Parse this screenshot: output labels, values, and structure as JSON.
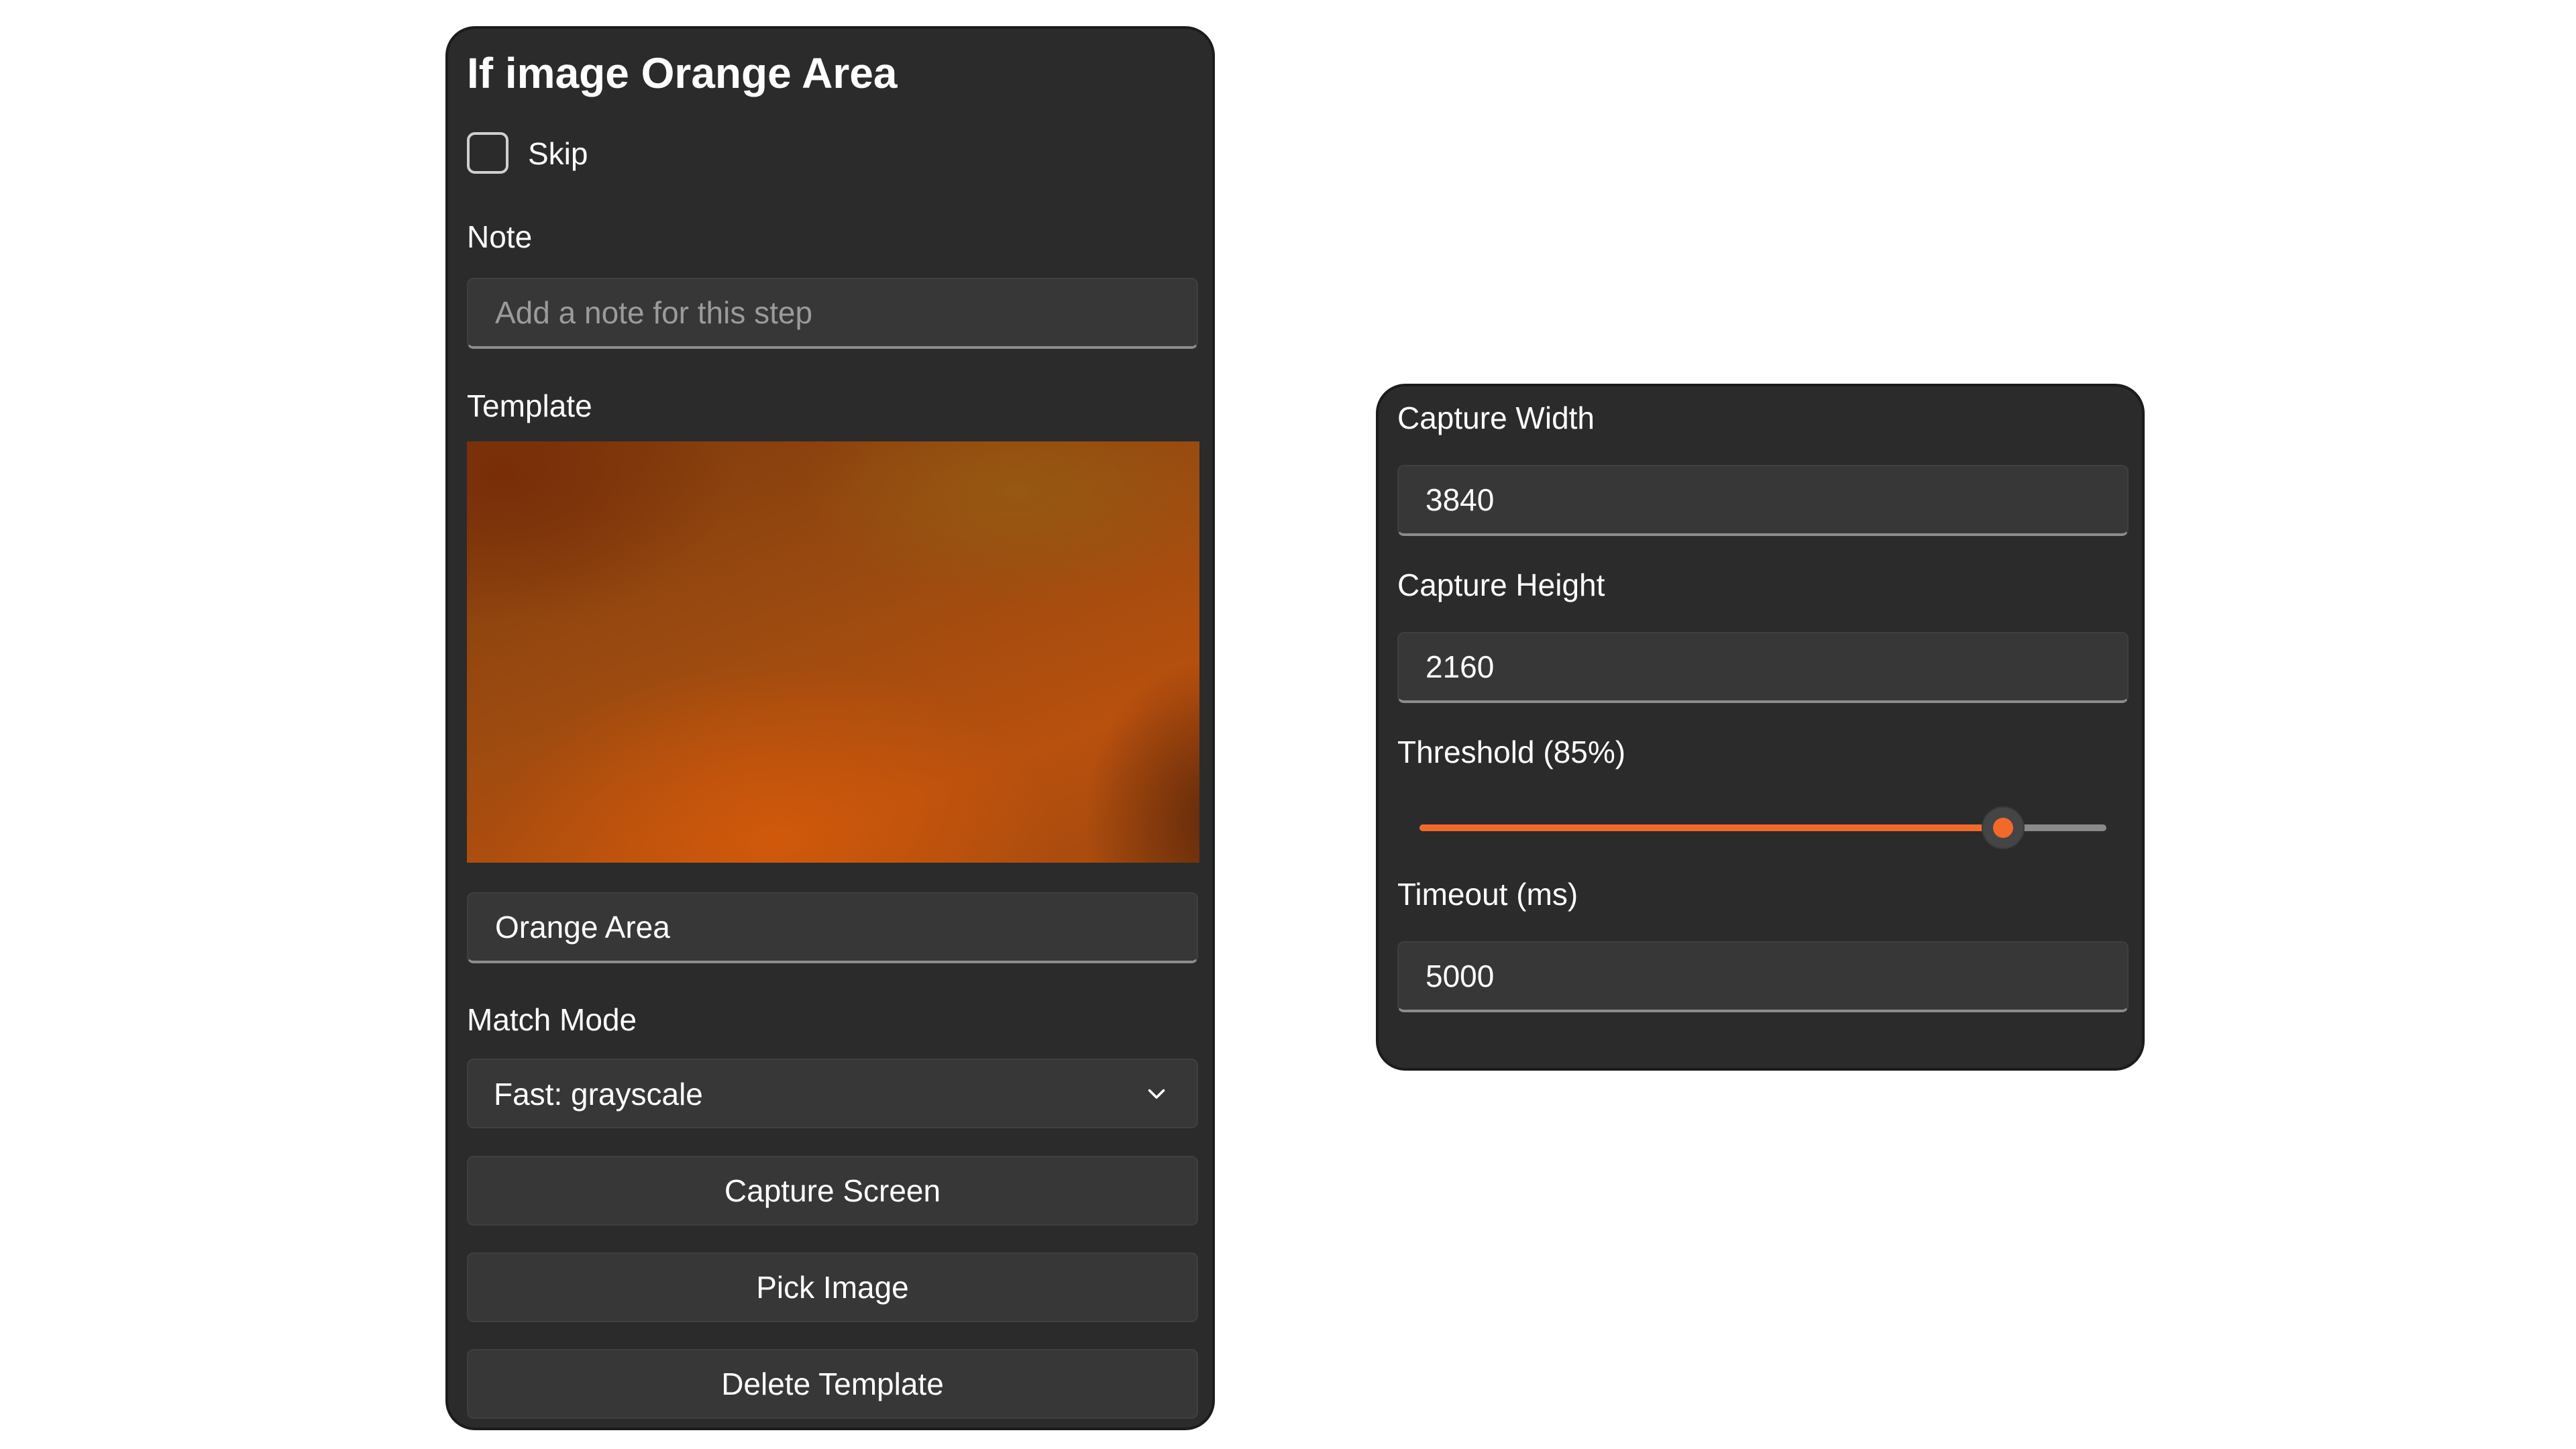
{
  "step": {
    "title": "If image Orange Area",
    "skip_label": "Skip",
    "skip_checked": false,
    "note_label": "Note",
    "note_placeholder": "Add a note for this step",
    "note_value": "",
    "template_label": "Template",
    "template_name": "Orange Area",
    "match_mode_label": "Match Mode",
    "match_mode_value": "Fast: grayscale",
    "buttons": {
      "capture_screen": "Capture Screen",
      "pick_image": "Pick Image",
      "delete_template": "Delete Template"
    }
  },
  "capture": {
    "width_label": "Capture Width",
    "width_value": "3840",
    "height_label": "Capture Height",
    "height_value": "2160",
    "threshold_label": "Threshold (85%)",
    "threshold_value": 85,
    "timeout_label": "Timeout (ms)",
    "timeout_value": "5000"
  },
  "colors": {
    "panel_bg": "#2b2b2b",
    "accent": "#f26a2a"
  },
  "icons": {
    "match_mode_dropdown": "chevron-down-icon"
  }
}
